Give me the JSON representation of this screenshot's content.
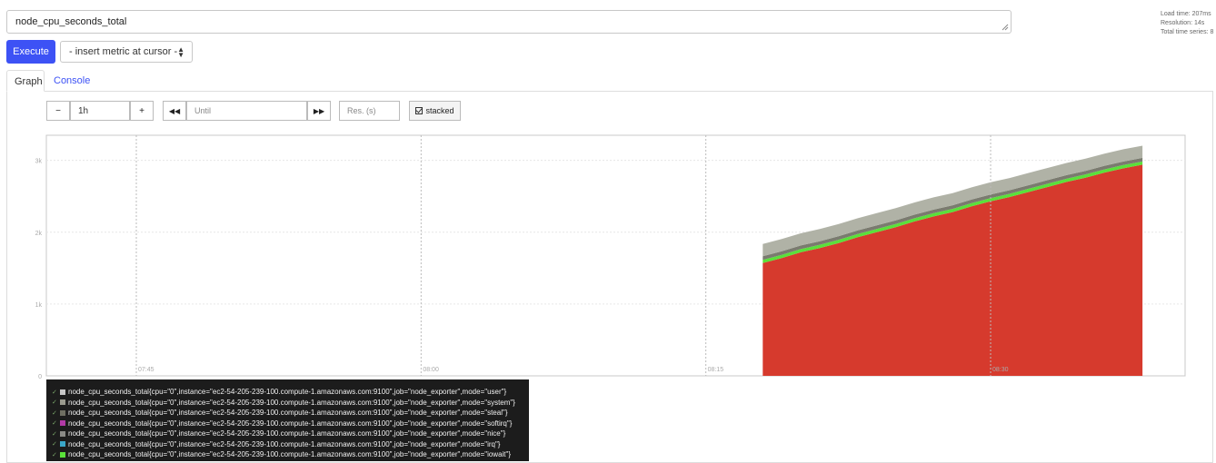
{
  "query": {
    "expression": "node_cpu_seconds_total"
  },
  "stats": {
    "load_time": "Load time: 207ms",
    "resolution": "Resolution: 14s",
    "total_series": "Total time series: 8"
  },
  "toolbar": {
    "execute_label": "Execute",
    "metric_select_label": "- insert metric at cursor -"
  },
  "tabs": {
    "graph": "Graph",
    "console": "Console"
  },
  "graph_controls": {
    "range_minus": "−",
    "range_value": "1h",
    "range_plus": "+",
    "back_label": "◀◀",
    "until_placeholder": "Until",
    "forward_label": "▶▶",
    "res_placeholder": "Res. (s)",
    "stacked_label": "stacked"
  },
  "chart_data": {
    "type": "area",
    "stacked": true,
    "x_ticks": [
      "07:45",
      "08:00",
      "08:15",
      "08:30"
    ],
    "y_ticks": [
      "0",
      "1k",
      "2k",
      "3k"
    ],
    "ylim": [
      0,
      3350
    ],
    "x": [
      "08:18",
      "08:19",
      "08:20",
      "08:21",
      "08:22",
      "08:23",
      "08:24",
      "08:25",
      "08:26",
      "08:27",
      "08:28",
      "08:29",
      "08:30",
      "08:31",
      "08:32",
      "08:33",
      "08:34",
      "08:35",
      "08:36",
      "08:37",
      "08:38"
    ],
    "series": [
      {
        "color": "#d63a2d",
        "values": [
          1570,
          1640,
          1720,
          1780,
          1850,
          1930,
          2000,
          2070,
          2150,
          2220,
          2280,
          2360,
          2430,
          2490,
          2560,
          2630,
          2700,
          2760,
          2830,
          2890,
          2940
        ]
      },
      {
        "color": "#5ae03a",
        "values": [
          45,
          45,
          45,
          45,
          45,
          45,
          45,
          45,
          45,
          45,
          45,
          45,
          45,
          45,
          45,
          45,
          45,
          45,
          45,
          45,
          45
        ]
      },
      {
        "color": "#7a7b6f",
        "values": [
          50,
          50,
          50,
          50,
          50,
          50,
          50,
          50,
          50,
          50,
          50,
          50,
          50,
          50,
          50,
          50,
          50,
          50,
          50,
          50,
          50
        ]
      },
      {
        "color": "#b0b2a6",
        "values": [
          170,
          170,
          170,
          170,
          170,
          170,
          170,
          170,
          170,
          170,
          170,
          170,
          170,
          170,
          170,
          170,
          170,
          170,
          170,
          170,
          170
        ]
      }
    ]
  },
  "legend": [
    {
      "text": "node_cpu_seconds_total{cpu=\"0\",instance=\"ec2-54-205-239-100.compute-1.amazonaws.com:9100\",job=\"node_exporter\",mode=\"user\"}",
      "color": "#c8c8c8"
    },
    {
      "text": "node_cpu_seconds_total{cpu=\"0\",instance=\"ec2-54-205-239-100.compute-1.amazonaws.com:9100\",job=\"node_exporter\",mode=\"system\"}",
      "color": "#9a9a8e"
    },
    {
      "text": "node_cpu_seconds_total{cpu=\"0\",instance=\"ec2-54-205-239-100.compute-1.amazonaws.com:9100\",job=\"node_exporter\",mode=\"steal\"}",
      "color": "#6f6f62"
    },
    {
      "text": "node_cpu_seconds_total{cpu=\"0\",instance=\"ec2-54-205-239-100.compute-1.amazonaws.com:9100\",job=\"node_exporter\",mode=\"softirq\"}",
      "color": "#b23aa6"
    },
    {
      "text": "node_cpu_seconds_total{cpu=\"0\",instance=\"ec2-54-205-239-100.compute-1.amazonaws.com:9100\",job=\"node_exporter\",mode=\"nice\"}",
      "color": "#8a8a86"
    },
    {
      "text": "node_cpu_seconds_total{cpu=\"0\",instance=\"ec2-54-205-239-100.compute-1.amazonaws.com:9100\",job=\"node_exporter\",mode=\"irq\"}",
      "color": "#3aa6c8"
    },
    {
      "text": "node_cpu_seconds_total{cpu=\"0\",instance=\"ec2-54-205-239-100.compute-1.amazonaws.com:9100\",job=\"node_exporter\",mode=\"iowait\"}",
      "color": "#5ae03a"
    }
  ]
}
